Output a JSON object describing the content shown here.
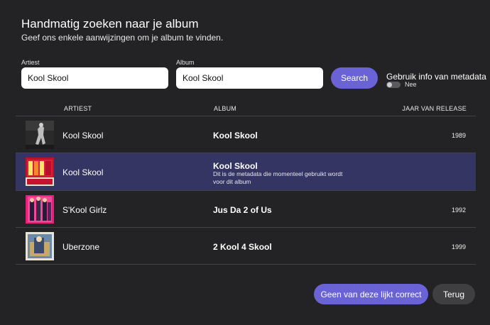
{
  "header": {
    "title": "Handmatig zoeken naar je album",
    "subtitle": "Geef ons enkele aanwijzingen om je album te vinden."
  },
  "form": {
    "artist_label": "Artiest",
    "artist_value": "Kool Skool",
    "album_label": "Album",
    "album_value": "Kool Skool",
    "search_label": "Search",
    "metadata_label": "Gebruik info van metadata",
    "metadata_toggle_state": "Nee"
  },
  "table": {
    "columns": {
      "artist": "ARTIEST",
      "album": "ALBUM",
      "year": "JAAR VAN RELEASE"
    },
    "rows": [
      {
        "artist": "Kool Skool",
        "album": "Kool Skool",
        "year": "1989",
        "note": "",
        "cover_icon": "album-cover-dark-photo"
      },
      {
        "artist": "Kool Skool",
        "album": "Kool Skool",
        "year": "",
        "note": "Dit is de metadata die momenteel gebruikt wordt voor dit album",
        "cover_icon": "album-cover-kool-skool"
      },
      {
        "artist": "S'Kool Girlz",
        "album": "Jus Da 2 of Us",
        "year": "1992",
        "note": "",
        "cover_icon": "album-cover-pink-group"
      },
      {
        "artist": "Uberzone",
        "album": "2 Kool 4 Skool",
        "year": "1999",
        "note": "",
        "cover_icon": "album-cover-uberzone"
      }
    ]
  },
  "footer": {
    "none_correct_label": "Geen van deze lijkt correct",
    "back_label": "Terug"
  },
  "colors": {
    "background": "#232325",
    "accent": "#6a63d6",
    "selected_row": "#343563",
    "secondary_button": "#3f3f42"
  }
}
